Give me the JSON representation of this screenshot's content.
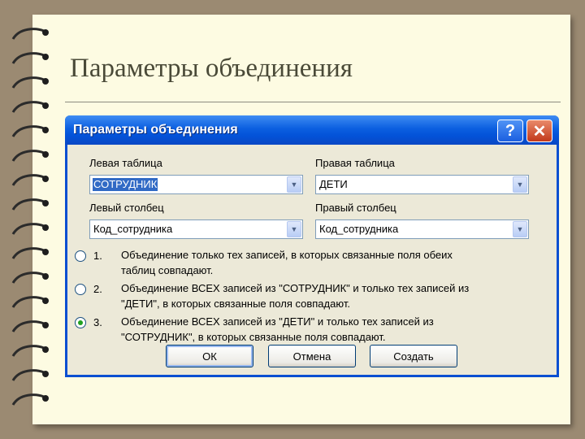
{
  "slide": {
    "title": "Параметры объединения"
  },
  "dialog": {
    "title": "Параметры объединения",
    "help_label": "?",
    "close_label": "✕",
    "left_table": {
      "label": "Левая таблица",
      "value": "СОТРУДНИК"
    },
    "right_table": {
      "label": "Правая таблица",
      "value": "ДЕТИ"
    },
    "left_column": {
      "label": "Левый столбец",
      "value": "Код_сотрудника"
    },
    "right_column": {
      "label": "Правый столбец",
      "value": "Код_сотрудника"
    },
    "options": [
      {
        "number": "1.",
        "line1": "Объединение только тех записей, в которых связанные поля обеих",
        "line2": "таблиц совпадают.",
        "selected": false
      },
      {
        "number": "2.",
        "line1": "Объединение ВСЕХ записей из \"СОТРУДНИК\" и только тех записей из",
        "line2": "\"ДЕТИ\", в которых связанные поля совпадают.",
        "selected": false
      },
      {
        "number": "3.",
        "line1": "Объединение ВСЕХ записей из \"ДЕТИ\" и только тех записей из",
        "line2": "\"СОТРУДНИК\", в которых связанные поля совпадают.",
        "selected": true
      }
    ],
    "buttons": {
      "ok": "ОК",
      "cancel": "Отмена",
      "create": "Создать"
    }
  },
  "icons": {
    "dropdown": "chevron-down-icon",
    "help": "help-icon",
    "close": "close-icon"
  },
  "colors": {
    "paper": "#fdfbe2",
    "titlebar": "#0b5fe0",
    "dialog_body": "#ece9d8",
    "selection": "#316ac5",
    "radio_dot": "#21a121"
  }
}
